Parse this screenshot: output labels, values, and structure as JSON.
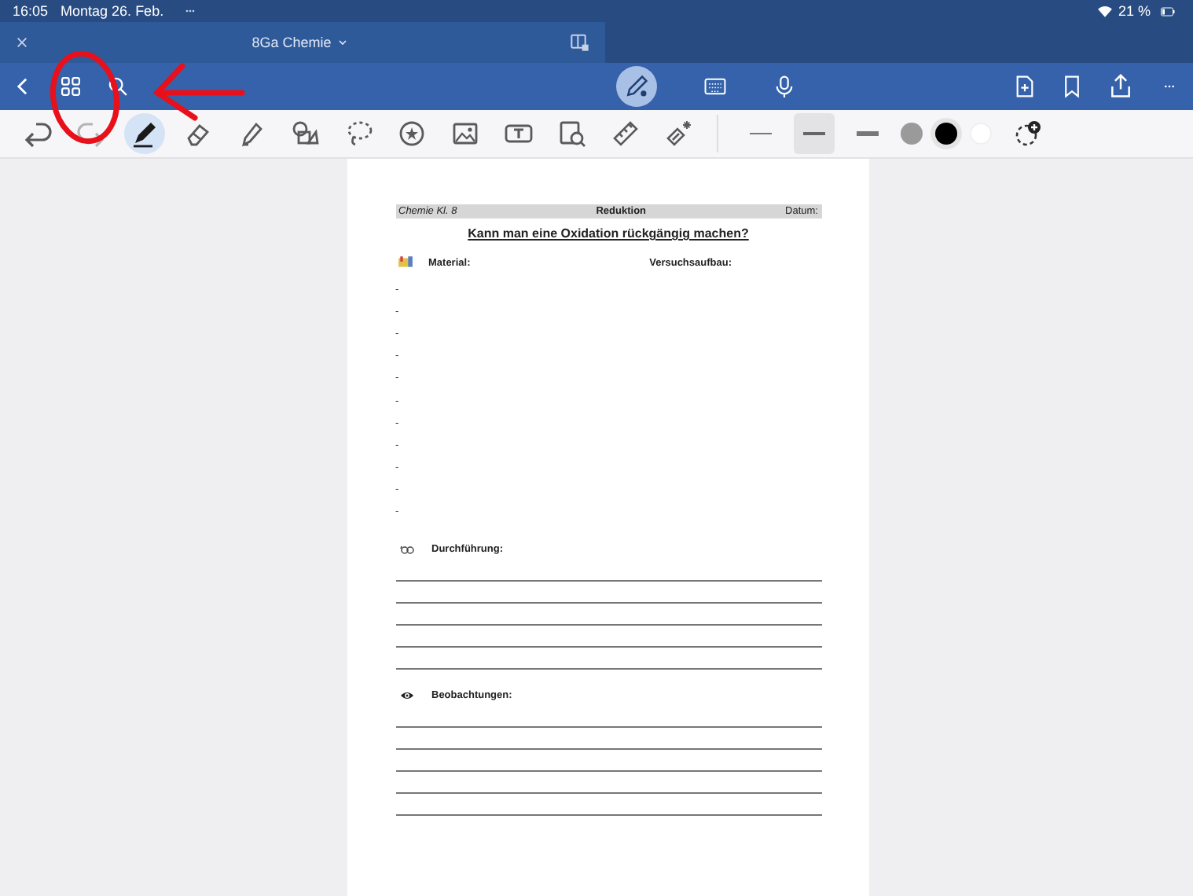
{
  "status_bar": {
    "time": "16:05",
    "date": "Montag 26. Feb.",
    "battery": "21 %"
  },
  "tab": {
    "title": "8Ga Chemie"
  },
  "toolbar": {
    "tools": [
      {
        "kind": "undo",
        "selected": false,
        "disabled": false
      },
      {
        "kind": "redo",
        "selected": false,
        "disabled": true
      },
      {
        "kind": "pen",
        "selected": true,
        "disabled": false
      },
      {
        "kind": "eraser",
        "selected": false,
        "disabled": false
      },
      {
        "kind": "highlighter",
        "selected": false,
        "disabled": false
      },
      {
        "kind": "shapes",
        "selected": false,
        "disabled": false
      },
      {
        "kind": "lasso",
        "selected": false,
        "disabled": false
      },
      {
        "kind": "sticker",
        "selected": false,
        "disabled": false
      },
      {
        "kind": "image",
        "selected": false,
        "disabled": false
      },
      {
        "kind": "textbox",
        "selected": false,
        "disabled": false
      },
      {
        "kind": "scan",
        "selected": false,
        "disabled": false
      },
      {
        "kind": "ruler",
        "selected": false,
        "disabled": false
      },
      {
        "kind": "magic",
        "selected": false,
        "disabled": false
      }
    ],
    "widths": [
      {
        "selected": false
      },
      {
        "selected": true
      },
      {
        "selected": false
      }
    ],
    "colors": [
      {
        "color": "#9a9a9a",
        "selected": false
      },
      {
        "color": "#000000",
        "selected": true
      },
      {
        "color": "#ffffff",
        "selected": false
      }
    ]
  },
  "document": {
    "header": [
      "Chemie Kl. 8",
      "Reduktion",
      "Datum:"
    ],
    "title": "Kann man eine Oxidation rückgängig machen?",
    "material_label": "Material:",
    "setup_label": "Versuchsaufbau:",
    "material_items": [
      "-",
      "-",
      "-",
      "-",
      "-",
      "-",
      "-",
      "-",
      "-",
      "-",
      "-"
    ],
    "sections": [
      {
        "kind": "procedure",
        "label": "Durchführung:"
      },
      {
        "kind": "observation",
        "label": "Beobachtungen:"
      }
    ]
  }
}
